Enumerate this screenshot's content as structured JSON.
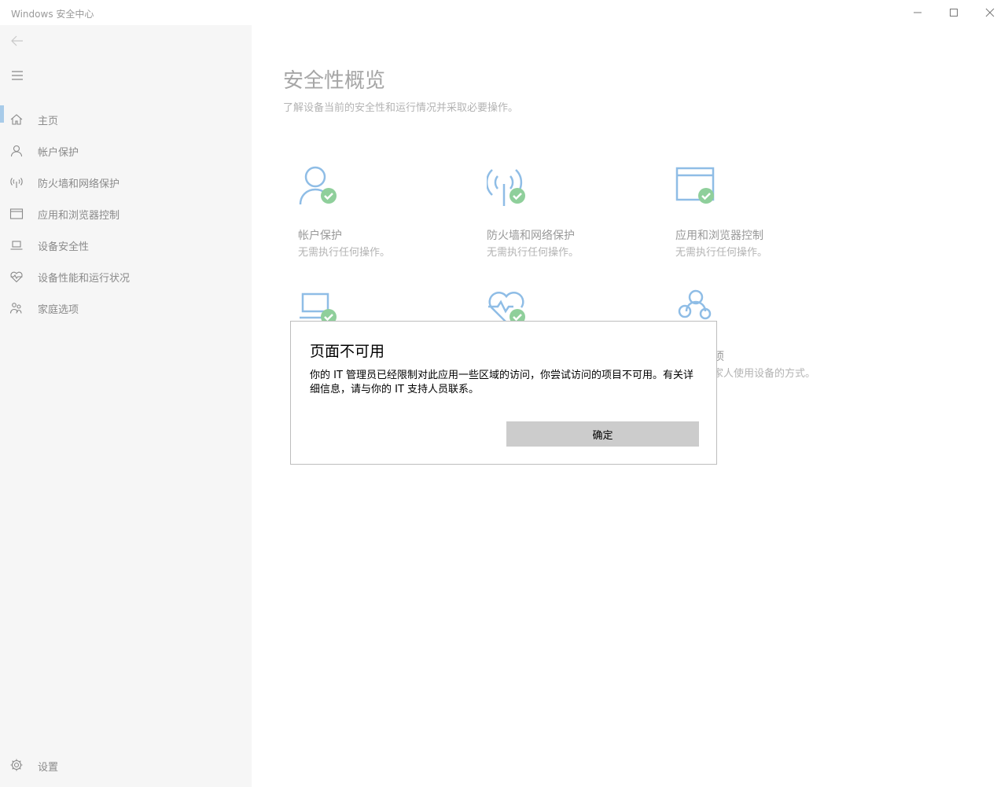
{
  "window": {
    "title": "Windows 安全中心",
    "controls": [
      "minimize-icon",
      "maximize-icon",
      "close-icon"
    ]
  },
  "sidebar": {
    "back_icon": "arrow-left-icon",
    "menu_icon": "hamburger-icon",
    "items": [
      {
        "label": "主页",
        "icon": "home-icon",
        "selected": true
      },
      {
        "label": "帐户保护",
        "icon": "person-icon",
        "selected": false
      },
      {
        "label": "防火墙和网络保护",
        "icon": "antenna-icon",
        "selected": false
      },
      {
        "label": "应用和浏览器控制",
        "icon": "browser-window-icon",
        "selected": false
      },
      {
        "label": "设备安全性",
        "icon": "laptop-icon",
        "selected": false
      },
      {
        "label": "设备性能和运行状况",
        "icon": "heart-pulse-icon",
        "selected": false
      },
      {
        "label": "家庭选项",
        "icon": "family-icon",
        "selected": false
      }
    ],
    "settings_label": "设置",
    "settings_icon": "gear-icon"
  },
  "main": {
    "title": "安全性概览",
    "subtitle": "了解设备当前的安全性和运行情况并采取必要操作。",
    "tiles": [
      {
        "name": "帐户保护",
        "status": "无需执行任何操作。",
        "icon": "person-check-icon"
      },
      {
        "name": "防火墙和网络保护",
        "status": "无需执行任何操作。",
        "icon": "antenna-check-icon"
      },
      {
        "name": "应用和浏览器控制",
        "status": "无需执行任何操作。",
        "icon": "browser-check-icon"
      },
      {
        "name": "",
        "status": "",
        "icon": "laptop-check-icon"
      },
      {
        "name": "",
        "status": "",
        "icon": "heart-check-icon"
      },
      {
        "name": "项",
        "status": "家人使用设备的方式。",
        "icon": "family-icon"
      }
    ]
  },
  "dialog": {
    "title": "页面不可用",
    "body": "你的 IT 管理员已经限制对此应用一些区域的访问，你尝试访问的项目不可用。有关详细信息，请与你的 IT 支持人员联系。",
    "ok_label": "确定"
  },
  "colors": {
    "accent": "#a8cbe9",
    "icon_blue": "#8fbde6",
    "check_green": "#8fcf9b",
    "sidebar_bg": "#f6f6f6"
  }
}
